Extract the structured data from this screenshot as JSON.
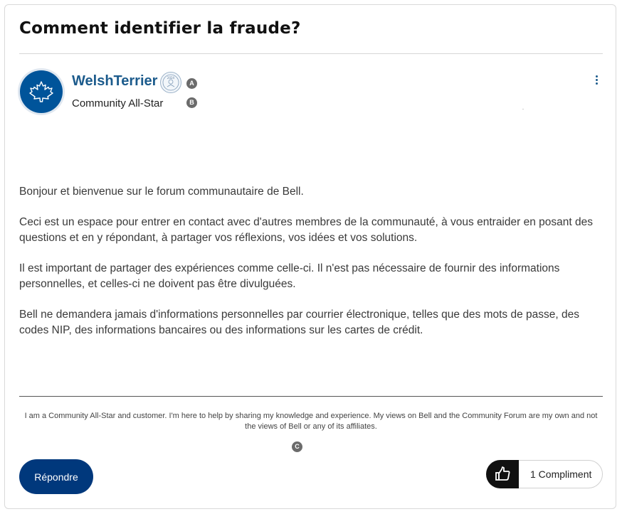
{
  "post": {
    "title": "Comment identifier la fraude?",
    "author": {
      "username": "WelshTerrier",
      "role": "Community All-Star",
      "avatar_icon": "maple-leaf-icon",
      "rank_badge_icon": "rank-badge-icon",
      "rank_badge_text": "2024"
    },
    "markers": {
      "a": "A",
      "b": "B",
      "c": "C"
    },
    "body": [
      "Bonjour et bienvenue sur le forum communautaire de Bell.",
      "Ceci est un espace pour entrer en contact avec d'autres membres de la communauté, à vous entraider en posant des questions et en y répondant, à partager vos réflexions, vos idées et vos solutions.",
      "Il est important de partager des expériences comme celle-ci. Il n'est pas nécessaire de fournir des informations personnelles, et celles-ci ne doivent pas être divulguées.",
      "Bell ne demandera jamais d'informations personnelles par courrier électronique, telles que des mots de passe, des codes NIP, des informations bancaires ou des informations sur les cartes de crédit."
    ],
    "signature": "I am a Community All-Star and customer. I'm here to help by sharing my knowledge and experience. My views on Bell and the Community Forum are my own and not the views of Bell or any of its affiliates."
  },
  "actions": {
    "reply_label": "Répondre",
    "kudos_label": "1 Compliment",
    "kudos_icon": "thumbs-up-icon",
    "menu_icon": "more-options-icon"
  },
  "colors": {
    "brand_blue": "#00549a",
    "button_navy": "#00387c",
    "username_blue": "#1c5b8c"
  }
}
